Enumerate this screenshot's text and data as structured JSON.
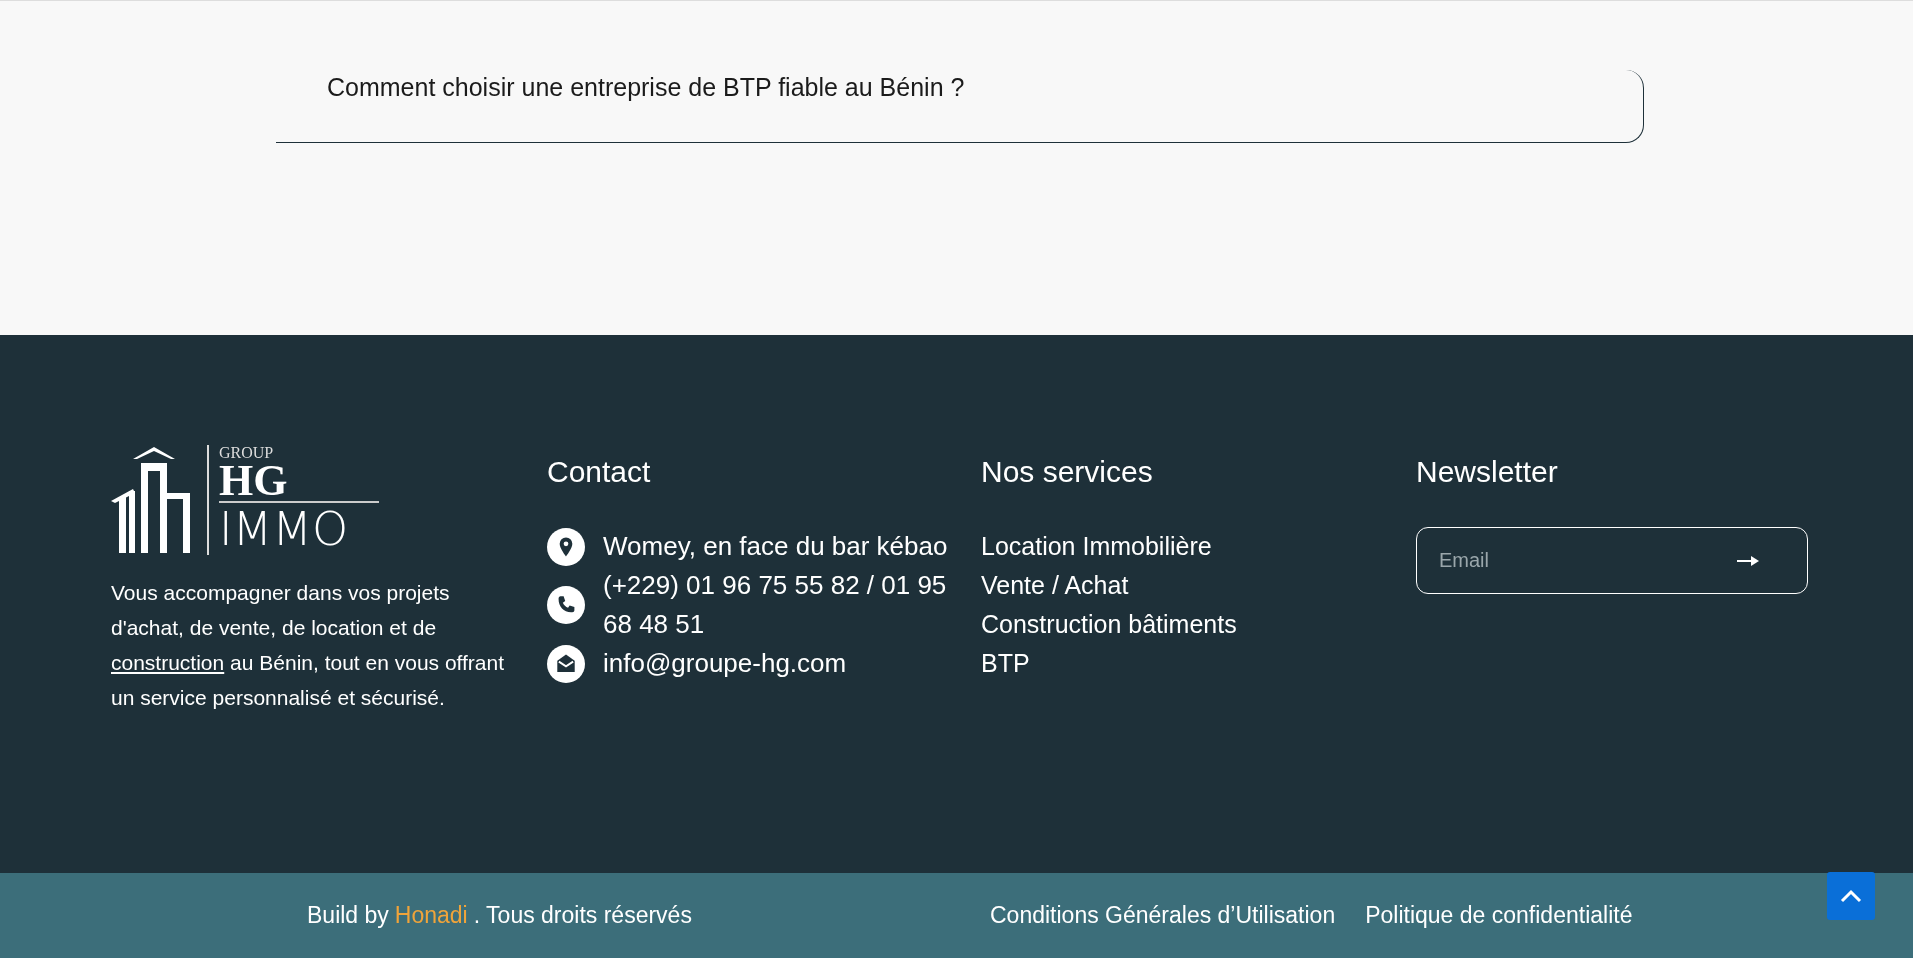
{
  "faq": {
    "items": [
      {
        "question": "Comment choisir une entreprise de BTP fiable au Bénin ?",
        "expanded": false
      }
    ]
  },
  "footer": {
    "logo": {
      "top": "GROUP",
      "middle": "HG",
      "bottom": "IMMO"
    },
    "description": {
      "before": "Vous accompagner dans vos projets d'achat, de vente, de location et de",
      "link": "construction",
      "after": "au Bénin, tout en vous offrant un service personnalisé et sécurisé."
    },
    "contact": {
      "title": "Contact",
      "items": [
        {
          "kind": "location",
          "text": "Womey, en face du bar kébao"
        },
        {
          "kind": "phone",
          "text": "(+229) 01 96 75 55 82 / 01 95 68 48 51"
        },
        {
          "kind": "email",
          "text": "info@groupe-hg.com"
        }
      ]
    },
    "services": {
      "title": "Nos services",
      "items": [
        "Location Immobilière",
        "Vente / Achat",
        "Construction bâtiments",
        "BTP"
      ]
    },
    "newsletter": {
      "title": "Newsletter",
      "placeholder": "Email"
    }
  },
  "bottom_bar": {
    "credit_prefix": "Build by",
    "credit_link": "Honadi",
    "credit_suffix": ". Tous droits réservés",
    "links": [
      "Conditions Générales d’Utilisation",
      "Politique de confidentialité"
    ]
  }
}
